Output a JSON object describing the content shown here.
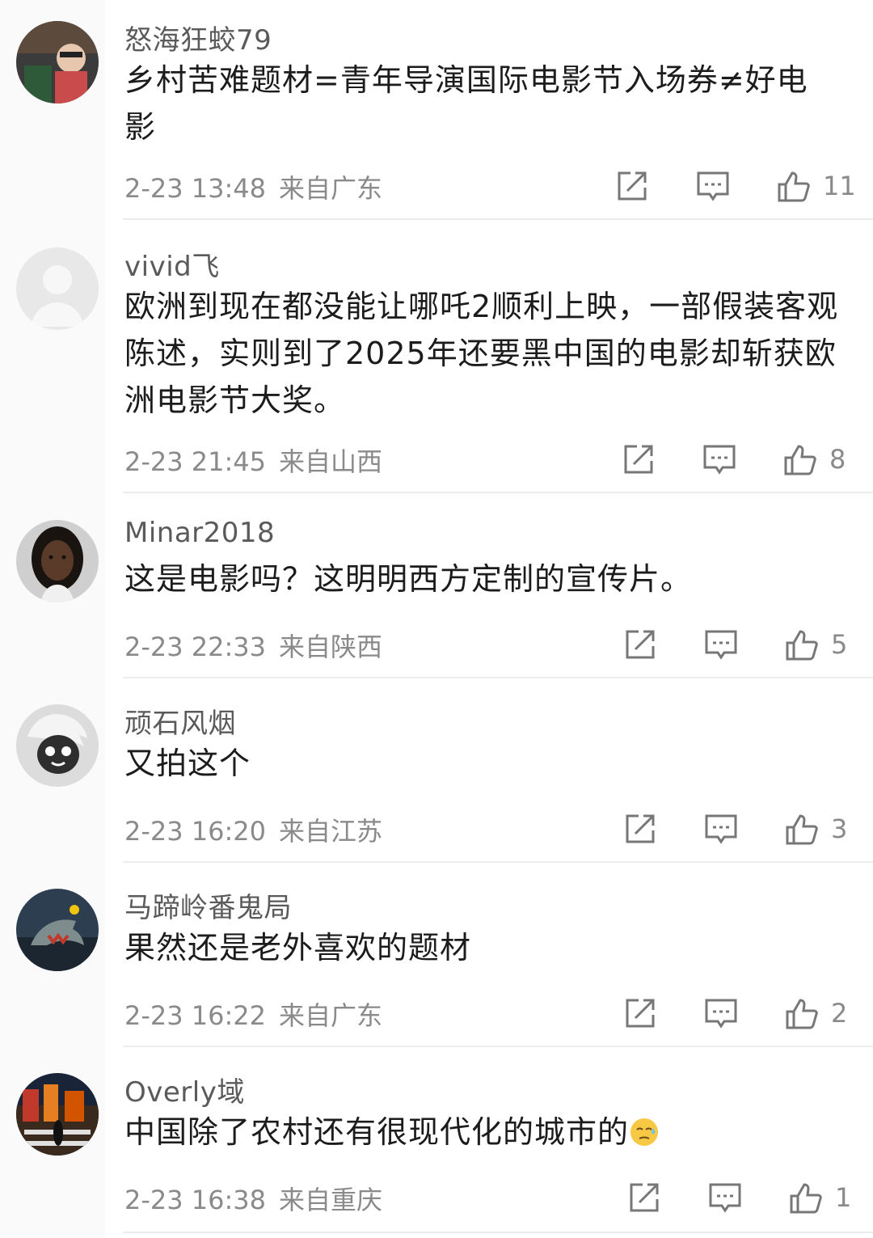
{
  "comments": [
    {
      "username": "怒海狂蛟79",
      "avatar_icon": "avatar-photo-child",
      "text": "乡村苦难题材=青年导演国际电影节入场券≠好电影",
      "time": "2-23 13:48",
      "location": "来自广东",
      "likes": "11"
    },
    {
      "username": "vivid飞",
      "avatar_icon": "avatar-default-placeholder",
      "text": "欧洲到现在都没能让哪吒2顺利上映，一部假装客观陈述，实则到了2025年还要黑中国的电影却斩获欧洲电影节大奖。",
      "time": "2-23 21:45",
      "location": "来自山西",
      "likes": "8"
    },
    {
      "username": "Minar2018",
      "avatar_icon": "avatar-photo-girl",
      "text": "这是电影吗？这明明西方定制的宣传片。",
      "time": "2-23 22:33",
      "location": "来自陕西",
      "likes": "5"
    },
    {
      "username": "顽石风烟",
      "avatar_icon": "avatar-cartoon-character",
      "text": "又拍这个",
      "time": "2-23 16:20",
      "location": "来自江苏",
      "likes": "3"
    },
    {
      "username": "马蹄岭番鬼局",
      "avatar_icon": "avatar-shark-illustration",
      "text": "果然还是老外喜欢的题材",
      "time": "2-23 16:22",
      "location": "来自广东",
      "likes": "2"
    },
    {
      "username": "Overly域",
      "avatar_icon": "avatar-city-street",
      "text": "中国除了农村还有很现代化的城市的",
      "emoji": "sweat-emoji",
      "time": "2-23 16:38",
      "location": "来自重庆",
      "likes": "1"
    }
  ],
  "icons": {
    "share": "share-icon",
    "reply": "reply-icon",
    "like": "thumbs-up-icon"
  },
  "colors": {
    "meta_text": "#8a8a8a",
    "username_text": "#5a5a5a",
    "divider": "#ececec"
  }
}
